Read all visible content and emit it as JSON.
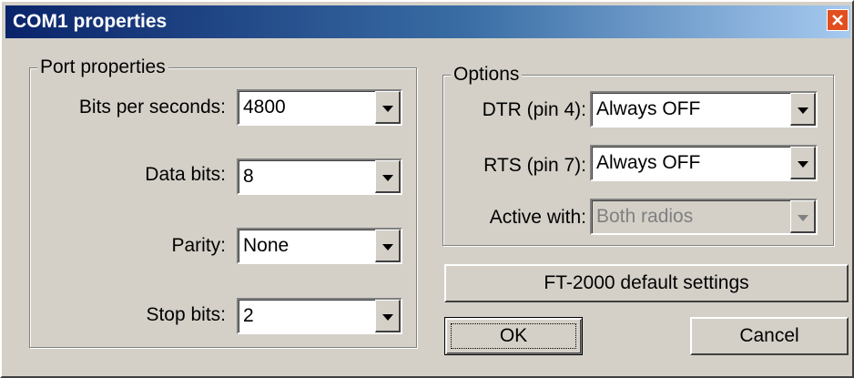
{
  "window": {
    "title": "COM1 properties",
    "close_icon": "close-icon"
  },
  "port_properties": {
    "legend": "Port properties",
    "fields": [
      {
        "label": "Bits per seconds:",
        "value": "4800"
      },
      {
        "label": "Data bits:",
        "value": "8"
      },
      {
        "label": "Parity:",
        "value": "None"
      },
      {
        "label": "Stop bits:",
        "value": "2"
      }
    ]
  },
  "options": {
    "legend": "Options",
    "fields": [
      {
        "label": "DTR (pin 4):",
        "value": "Always OFF",
        "enabled": true
      },
      {
        "label": "RTS (pin 7):",
        "value": "Always OFF",
        "enabled": true
      },
      {
        "label": "Active with:",
        "value": "Both radios",
        "enabled": false
      }
    ]
  },
  "buttons": {
    "defaults": "FT-2000 default settings",
    "ok": "OK",
    "cancel": "Cancel"
  },
  "colors": {
    "titlebar_start": "#0a246a",
    "titlebar_end": "#a6caf0",
    "close_button": "#e24e1e",
    "face": "#d4d0c8"
  }
}
